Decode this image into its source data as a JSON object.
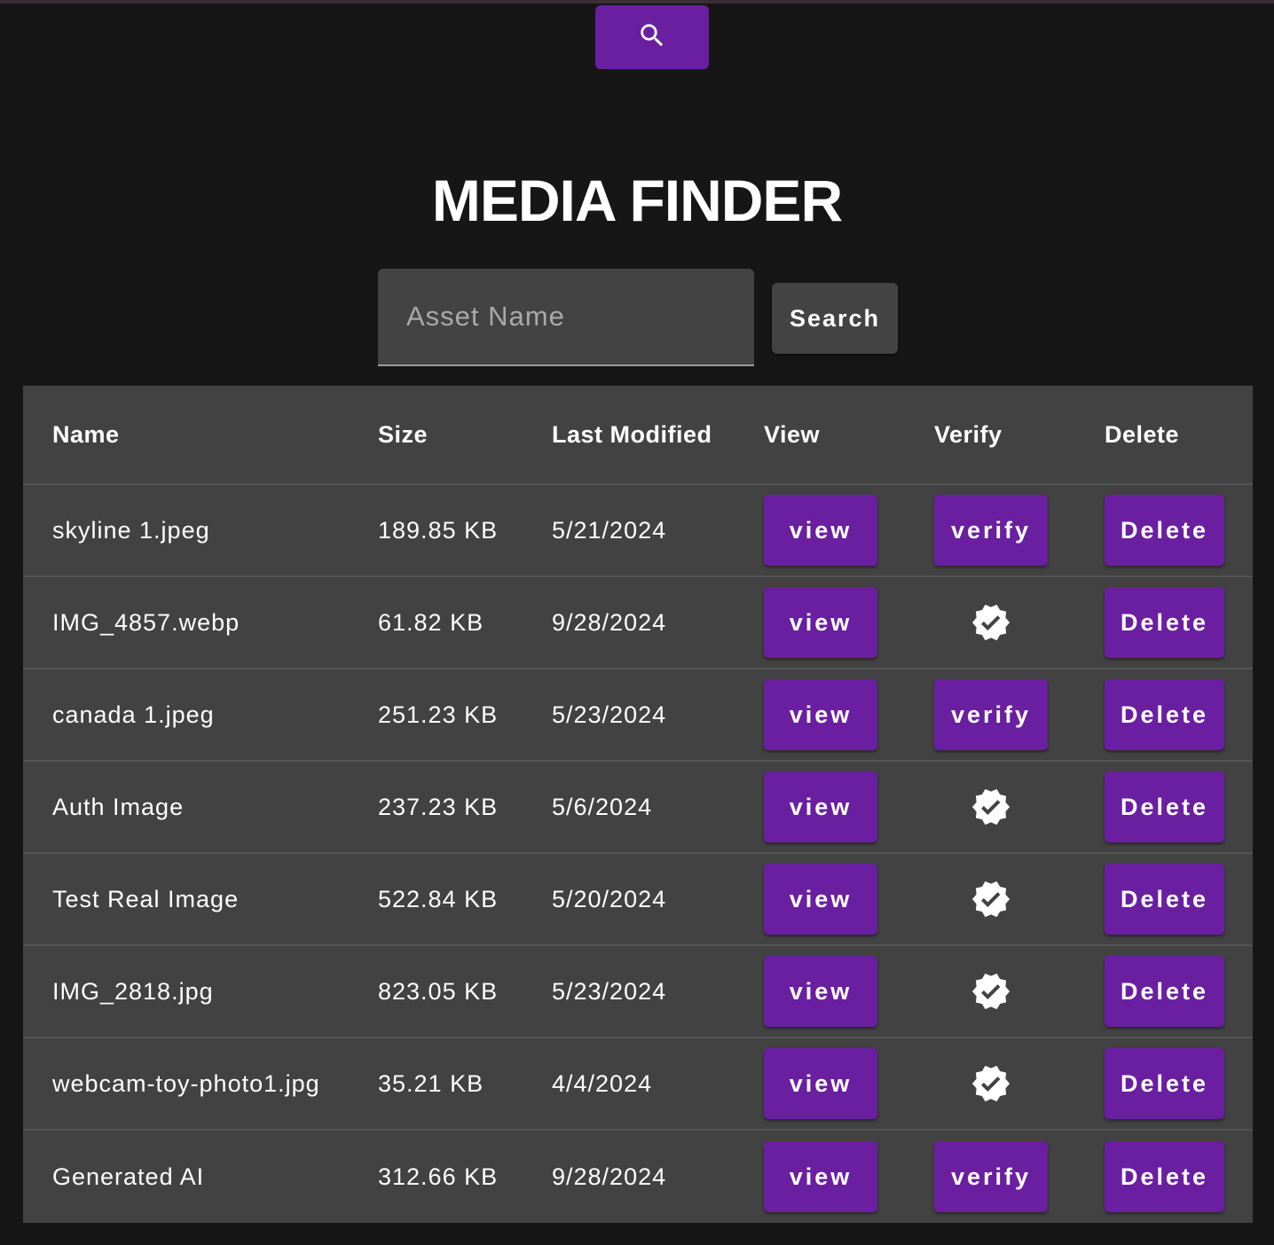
{
  "header": {
    "search_icon": "search-icon",
    "title": "MEDIA FINDER"
  },
  "search": {
    "placeholder": "Asset Name",
    "value": "",
    "button_label": "Search"
  },
  "colors": {
    "accent": "#6a1fa0",
    "background": "#161616",
    "surface": "#424242"
  },
  "table": {
    "columns": [
      "Name",
      "Size",
      "Last Modified",
      "View",
      "Verify",
      "Delete"
    ],
    "rows": [
      {
        "name": "skyline 1.jpeg",
        "size": "189.85 KB",
        "modified": "5/21/2024",
        "view": "view",
        "verified": false,
        "verify": "verify",
        "delete": "Delete"
      },
      {
        "name": "IMG_4857.webp",
        "size": "61.82 KB",
        "modified": "9/28/2024",
        "view": "view",
        "verified": true,
        "verify": "verify",
        "delete": "Delete"
      },
      {
        "name": "canada 1.jpeg",
        "size": "251.23 KB",
        "modified": "5/23/2024",
        "view": "view",
        "verified": false,
        "verify": "verify",
        "delete": "Delete"
      },
      {
        "name": "Auth Image",
        "size": "237.23 KB",
        "modified": "5/6/2024",
        "view": "view",
        "verified": true,
        "verify": "verify",
        "delete": "Delete"
      },
      {
        "name": "Test Real Image",
        "size": "522.84 KB",
        "modified": "5/20/2024",
        "view": "view",
        "verified": true,
        "verify": "verify",
        "delete": "Delete"
      },
      {
        "name": "IMG_2818.jpg",
        "size": "823.05 KB",
        "modified": "5/23/2024",
        "view": "view",
        "verified": true,
        "verify": "verify",
        "delete": "Delete"
      },
      {
        "name": "webcam-toy-photo1.jpg",
        "size": "35.21 KB",
        "modified": "4/4/2024",
        "view": "view",
        "verified": true,
        "verify": "verify",
        "delete": "Delete"
      },
      {
        "name": "Generated AI",
        "size": "312.66 KB",
        "modified": "9/28/2024",
        "view": "view",
        "verified": false,
        "verify": "verify",
        "delete": "Delete"
      }
    ]
  }
}
